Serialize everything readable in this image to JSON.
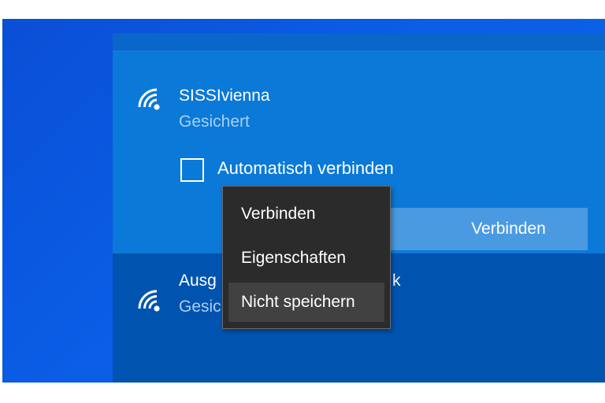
{
  "networks": [
    {
      "name": "SISSIvienna",
      "status": "Gesichert",
      "auto_connect_label": "Automatisch verbinden",
      "auto_connect_checked": false,
      "connect_button_label": "Verbinden",
      "icon": "wifi-signal-icon"
    },
    {
      "name_visible_start": "Ausg",
      "name_visible_end": "k",
      "status_visible": "Gesic",
      "icon": "wifi-signal-icon"
    }
  ],
  "context_menu": {
    "items": [
      {
        "label": "Verbinden"
      },
      {
        "label": "Eigenschaften"
      },
      {
        "label": "Nicht speichern",
        "highlighted": true
      }
    ]
  },
  "colors": {
    "desktop_blue": "#0b5ee6",
    "flyout_selected": "#0b79d8",
    "flyout_bg": "#0054b0",
    "button_bg": "#4a9ae2",
    "menu_bg": "#2b2b2b",
    "menu_hover": "#414141",
    "status_text": "#a9cff2"
  }
}
